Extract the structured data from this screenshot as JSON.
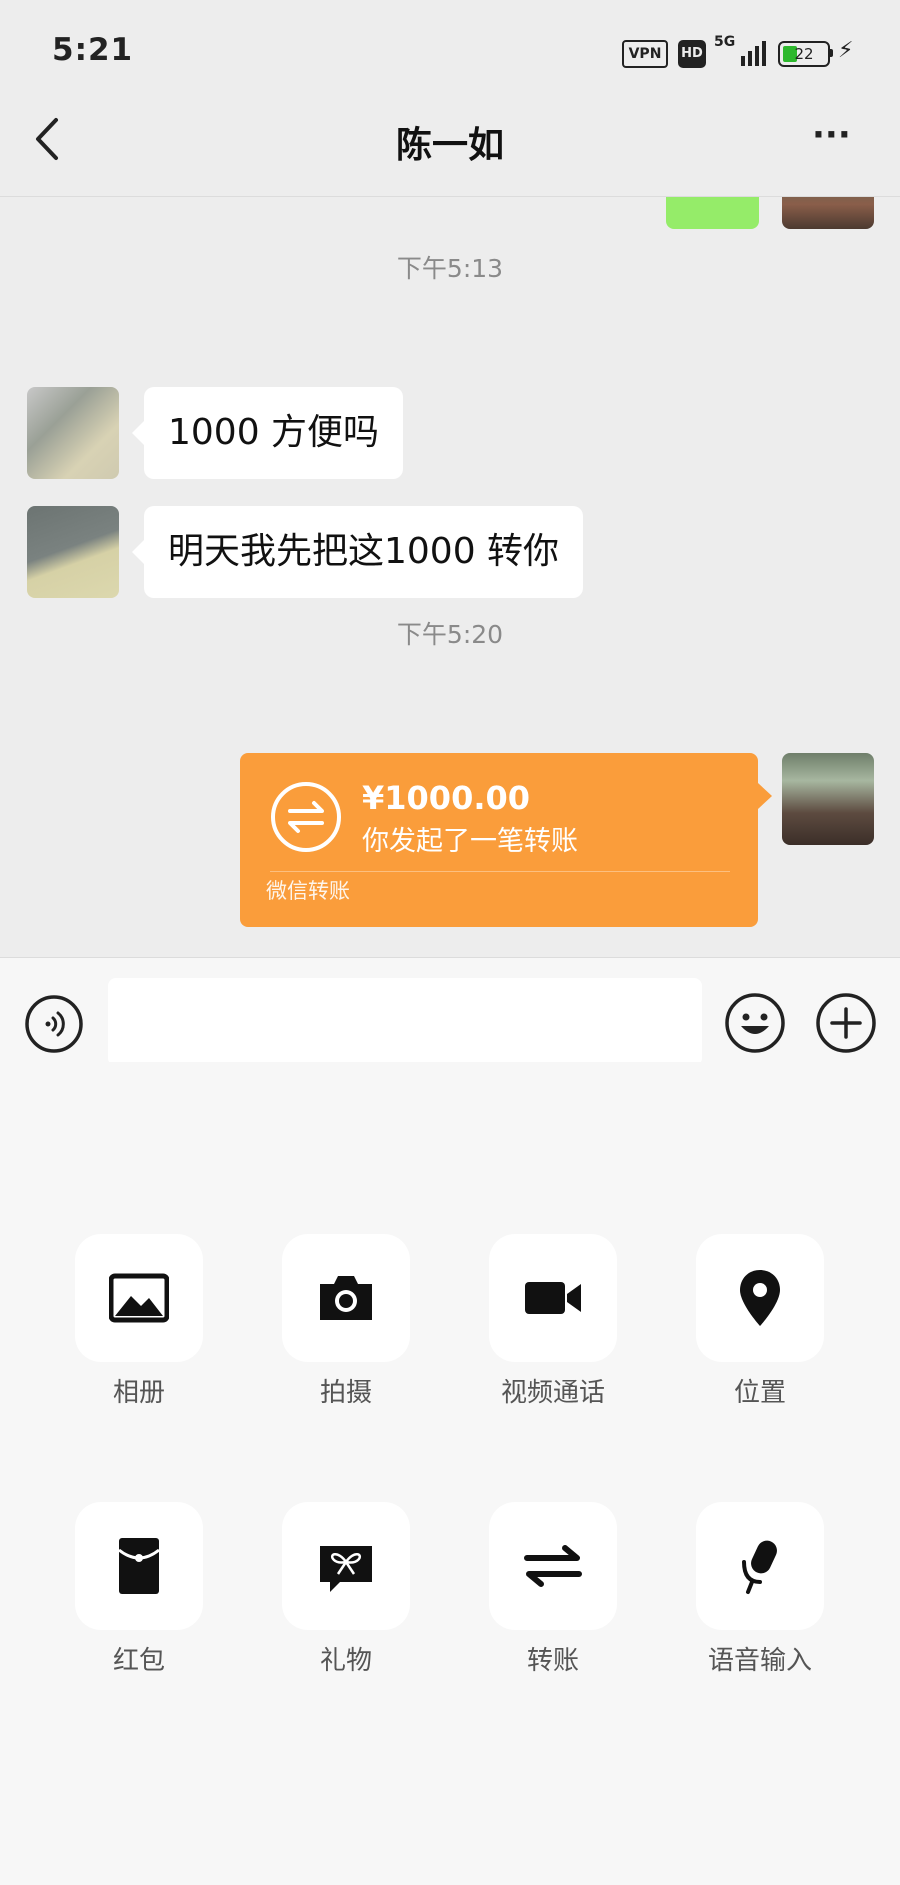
{
  "status_bar": {
    "time": "5:21",
    "vpn": "VPN",
    "hd": "HD",
    "network": "5G",
    "battery": "22"
  },
  "header": {
    "title": "陈一如",
    "more": "···"
  },
  "chat": {
    "timestamps": [
      "下午5:13",
      "下午5:20"
    ],
    "incoming_messages": [
      "1000 方便吗",
      "明天我先把这1000 转你"
    ],
    "transfer": {
      "amount": "¥1000.00",
      "description": "你发起了一笔转账",
      "footer": "微信转账"
    }
  },
  "input": {
    "placeholder": ""
  },
  "panel": {
    "items": [
      {
        "label": "相册",
        "icon": "album-icon"
      },
      {
        "label": "拍摄",
        "icon": "camera-icon"
      },
      {
        "label": "视频通话",
        "icon": "video-call-icon"
      },
      {
        "label": "位置",
        "icon": "location-icon"
      },
      {
        "label": "红包",
        "icon": "red-packet-icon"
      },
      {
        "label": "礼物",
        "icon": "gift-icon"
      },
      {
        "label": "转账",
        "icon": "transfer-icon"
      },
      {
        "label": "语音输入",
        "icon": "microphone-icon"
      }
    ]
  },
  "colors": {
    "background": "#ededed",
    "transfer_bubble": "#fa9d3b",
    "sent_bubble": "#95ec69",
    "battery": "#2db82d"
  }
}
